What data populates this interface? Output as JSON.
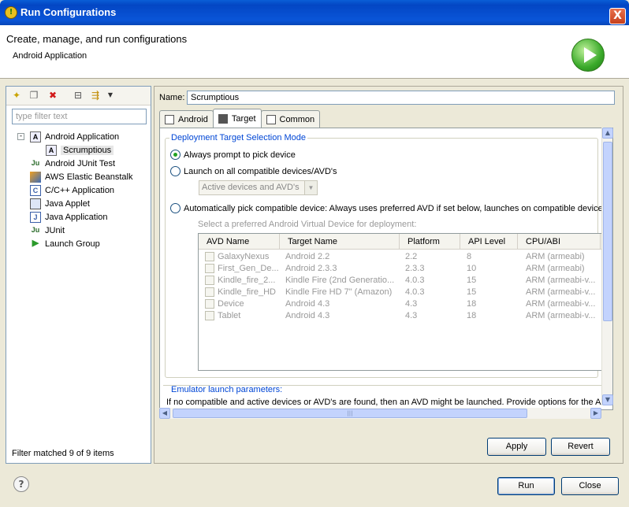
{
  "window": {
    "title": "Run Configurations",
    "close_glyph": "X",
    "app_icon_glyph": "!"
  },
  "header": {
    "title": "Create, manage, and run configurations",
    "subtitle": "Android Application"
  },
  "left": {
    "filter_placeholder": "type filter text",
    "tree": [
      {
        "label": "Android Application",
        "icon": "android-app-icon",
        "glyph": "A",
        "expanded": true
      },
      {
        "label": "Scrumptious",
        "icon": "android-app-icon",
        "glyph": "A",
        "selected": true
      },
      {
        "label": "Android JUnit Test",
        "icon": "junit-icon",
        "glyph": "Ju"
      },
      {
        "label": "AWS Elastic Beanstalk",
        "icon": "aws-icon",
        "glyph": ""
      },
      {
        "label": "C/C++ Application",
        "icon": "c-icon",
        "glyph": "C"
      },
      {
        "label": "Java Applet",
        "icon": "java-applet-icon",
        "glyph": ""
      },
      {
        "label": "Java Application",
        "icon": "java-app-icon",
        "glyph": "J"
      },
      {
        "label": "JUnit",
        "icon": "junit-icon",
        "glyph": "Ju"
      },
      {
        "label": "Launch Group",
        "icon": "launch-group-icon",
        "glyph": "▶"
      }
    ],
    "status": "Filter matched 9 of 9 items"
  },
  "right": {
    "name_label": "Name:",
    "name_value": "Scrumptious",
    "tabs": [
      {
        "label": "Android",
        "active": false
      },
      {
        "label": "Target",
        "active": true
      },
      {
        "label": "Common",
        "active": false
      }
    ],
    "deployment_title": "Deployment Target Selection Mode",
    "radio_always": "Always prompt to pick device",
    "radio_launch_all": "Launch on all compatible devices/AVD's",
    "combo_value": "Active devices and AVD's",
    "radio_auto": "Automatically pick compatible device: Always uses preferred AVD if set below, launches on compatible device/A",
    "avd_caption": "Select a preferred Android Virtual Device for deployment:",
    "table_headers": [
      "AVD Name",
      "Target Name",
      "Platform",
      "API Level",
      "CPU/ABI"
    ],
    "table_rows": [
      [
        "GalaxyNexus",
        "Android 2.2",
        "2.2",
        "8",
        "ARM (armeabi)"
      ],
      [
        "First_Gen_De...",
        "Android 2.3.3",
        "2.3.3",
        "10",
        "ARM (armeabi)"
      ],
      [
        "Kindle_fire_2...",
        "Kindle Fire (2nd Generatio...",
        "4.0.3",
        "15",
        "ARM (armeabi-v..."
      ],
      [
        "Kindle_fire_HD",
        "Kindle Fire HD 7\" (Amazon)",
        "4.0.3",
        "15",
        "ARM (armeabi-v..."
      ],
      [
        "Device",
        "Android 4.3",
        "4.3",
        "18",
        "ARM (armeabi-v..."
      ],
      [
        "Tablet",
        "Android 4.3",
        "4.3",
        "18",
        "ARM (armeabi-v..."
      ]
    ],
    "emulator_title": "Emulator launch parameters:",
    "emulator_text": "If no compatible and active devices or AVD's are found, then an AVD might be launched. Provide options for the A'",
    "apply": "Apply",
    "revert": "Revert"
  },
  "footer": {
    "run": "Run",
    "close": "Close",
    "help_glyph": "?"
  }
}
